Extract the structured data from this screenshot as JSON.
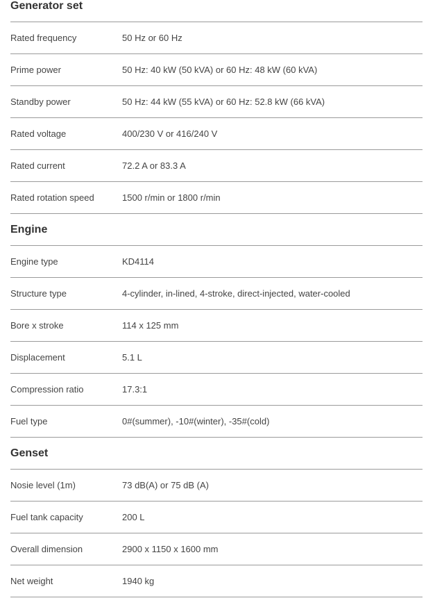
{
  "sections": [
    {
      "title": "Generator set",
      "rows": [
        {
          "label": "Rated frequency",
          "value": "50 Hz or 60 Hz"
        },
        {
          "label": "Prime power",
          "value": "50 Hz: 40 kW (50 kVA) or 60 Hz: 48 kW (60 kVA)"
        },
        {
          "label": "Standby power",
          "value": "50 Hz: 44 kW (55 kVA) or 60 Hz: 52.8 kW (66 kVA)"
        },
        {
          "label": "Rated voltage",
          "value": "400/230 V or 416/240 V"
        },
        {
          "label": "Rated current",
          "value": "72.2 A or 83.3 A"
        },
        {
          "label": "Rated rotation speed",
          "value": "1500 r/min or 1800 r/min"
        }
      ]
    },
    {
      "title": "Engine",
      "rows": [
        {
          "label": "Engine type",
          "value": "KD4114"
        },
        {
          "label": "Structure type",
          "value": "4-cylinder, in-lined, 4-stroke, direct-injected, water-cooled"
        },
        {
          "label": "Bore x stroke",
          "value": "114 x 125 mm"
        },
        {
          "label": "Displacement",
          "value": "5.1 L"
        },
        {
          "label": "Compression ratio",
          "value": "17.3:1"
        },
        {
          "label": "Fuel type",
          "value": "0#(summer), -10#(winter), -35#(cold)"
        }
      ]
    },
    {
      "title": "Genset",
      "rows": [
        {
          "label": "Nosie level (1m)",
          "value": "73 dB(A) or 75 dB (A)"
        },
        {
          "label": "Fuel tank capacity",
          "value": "200 L"
        },
        {
          "label": "Overall dimension",
          "value": "2900 x 1150 x 1600 mm"
        },
        {
          "label": "Net weight",
          "value": "1940 kg"
        }
      ]
    }
  ]
}
